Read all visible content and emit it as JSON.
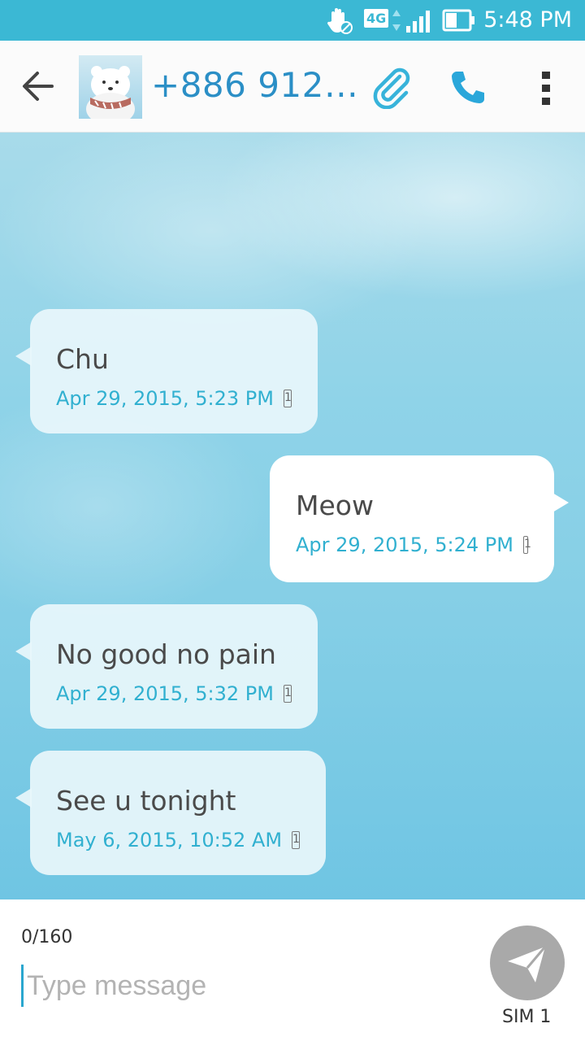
{
  "status_bar": {
    "time": "5:48 PM",
    "network": "4G"
  },
  "header": {
    "contact": "+886 912…"
  },
  "messages": [
    {
      "text": "Chu",
      "timestamp": "Apr 29, 2015, 5:23 PM",
      "direction": "received"
    },
    {
      "text": "Meow",
      "timestamp": "Apr 29, 2015, 5:24 PM",
      "direction": "sent"
    },
    {
      "text": "No good no pain",
      "timestamp": "Apr 29, 2015, 5:32 PM",
      "direction": "received"
    },
    {
      "text": "See u tonight",
      "timestamp": "May 6, 2015, 10:52 AM",
      "direction": "received"
    }
  ],
  "compose": {
    "char_count": "0/160",
    "placeholder": "Type message",
    "sim_label": "SIM 1"
  },
  "colors": {
    "accent": "#31b0d0",
    "status_bar": "#3bb8d4",
    "contact": "#2b8fc6",
    "send_button": "#a9a9a9"
  }
}
